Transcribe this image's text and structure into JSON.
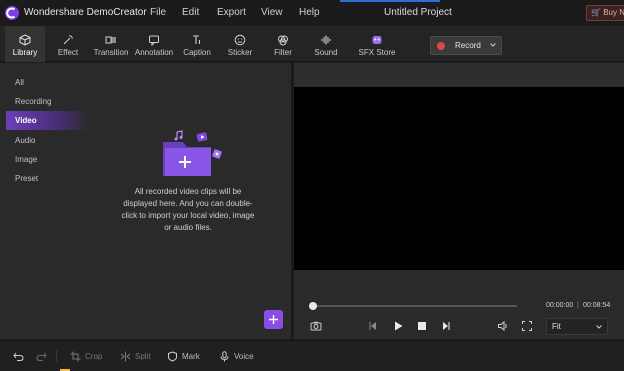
{
  "app": {
    "name": "Wondershare DemoCreator",
    "project_title": "Untitled Project",
    "buy_label": "Buy N"
  },
  "menu": {
    "file": "File",
    "edit": "Edit",
    "export": "Export",
    "view": "View",
    "help": "Help"
  },
  "toolbar": {
    "tabs": [
      {
        "label": "Library",
        "icon": "cube-icon"
      },
      {
        "label": "Effect",
        "icon": "magic-wand-icon"
      },
      {
        "label": "Transition",
        "icon": "transition-icon"
      },
      {
        "label": "Annotation",
        "icon": "annotation-icon"
      },
      {
        "label": "Caption",
        "icon": "caption-icon"
      },
      {
        "label": "Sticker",
        "icon": "sticker-icon"
      },
      {
        "label": "Filter",
        "icon": "filter-icon"
      },
      {
        "label": "Sound",
        "icon": "sound-wave-icon"
      },
      {
        "label": "SFX Store",
        "icon": "sfx-store-icon"
      }
    ],
    "active_tab": "Library",
    "record_label": "Record"
  },
  "library": {
    "categories": [
      "All",
      "Recording",
      "Video",
      "Audio",
      "Image",
      "Preset"
    ],
    "active_category": "Video",
    "empty_message": "All recorded video clips will be displayed here. And you can double-click to import your local video, image or audio files."
  },
  "player": {
    "current_time": "00:00:00",
    "total_time": "00:08:54",
    "zoom_option": "Fit",
    "progress": 0
  },
  "bottom_toolbar": {
    "crop": "Crop",
    "split": "Split",
    "mark": "Mark",
    "voice": "Voice"
  },
  "colors": {
    "accent": "#8a4ee6",
    "record_dot": "#e04848",
    "background": "#1e1e1e",
    "panel": "#2a2a2b"
  }
}
